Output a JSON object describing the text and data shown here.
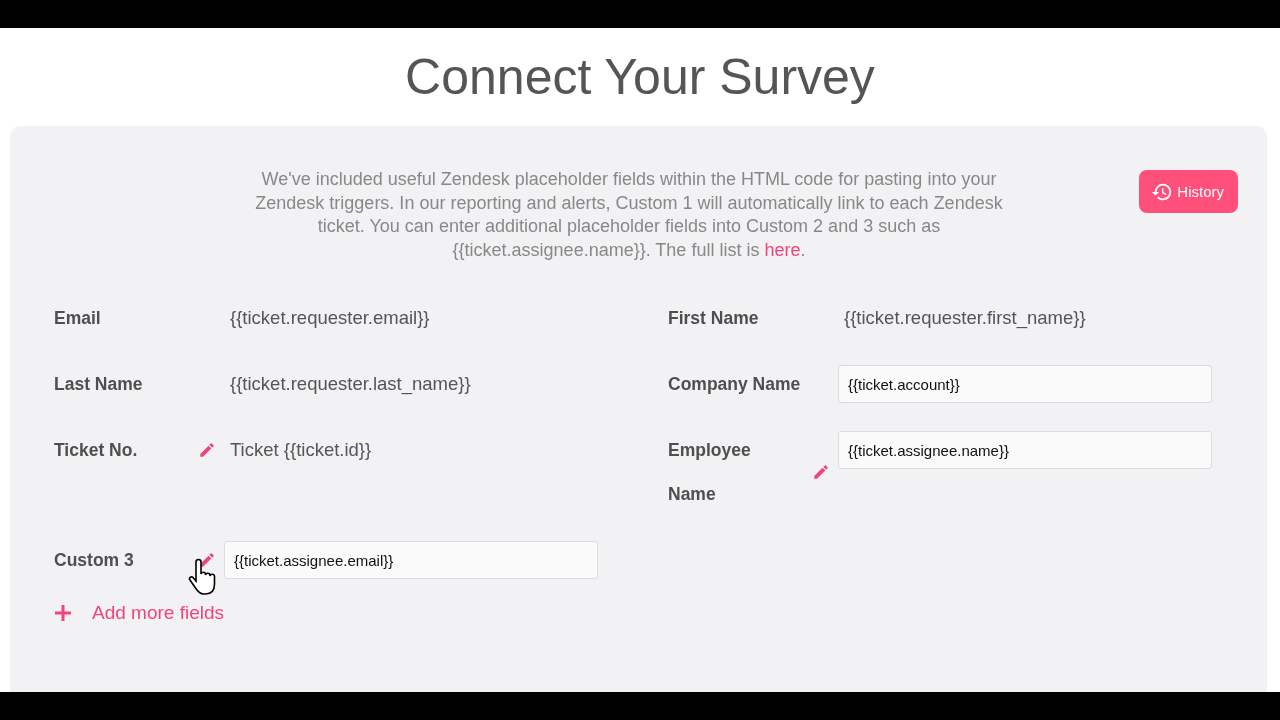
{
  "title": "Connect Your Survey",
  "history_button": {
    "label": "History"
  },
  "intro": {
    "text": "We've included useful Zendesk placeholder fields within the HTML code for pasting into your Zendesk triggers. In our reporting and alerts, Custom 1 will automatically link to each Zendesk ticket. You can enter additional placeholder fields into Custom 2 and 3 such as {{ticket.assignee.name}}. The full list is ",
    "link": "here",
    "after": "."
  },
  "left_fields": [
    {
      "label": "Email",
      "kind": "text",
      "editable": false,
      "value": "{{ticket.requester.email}}"
    },
    {
      "label": "Last Name",
      "kind": "text",
      "editable": false,
      "value": "{{ticket.requester.last_name}}"
    },
    {
      "label": "Ticket No.",
      "kind": "text",
      "editable": true,
      "value": "Ticket {{ticket.id}}"
    },
    {
      "label": "Custom 3",
      "kind": "input",
      "editable": true,
      "value": "{{ticket.assignee.email}}"
    }
  ],
  "right_fields": [
    {
      "label": "First Name",
      "kind": "text",
      "editable": false,
      "value": "{{ticket.requester.first_name}}"
    },
    {
      "label": "Company Name",
      "kind": "input",
      "editable": false,
      "value": "{{ticket.account}}"
    },
    {
      "label": "Employee Name",
      "kind": "input",
      "editable": true,
      "value": "{{ticket.assignee.name}}"
    }
  ],
  "add_button": {
    "label": "Add more fields"
  }
}
